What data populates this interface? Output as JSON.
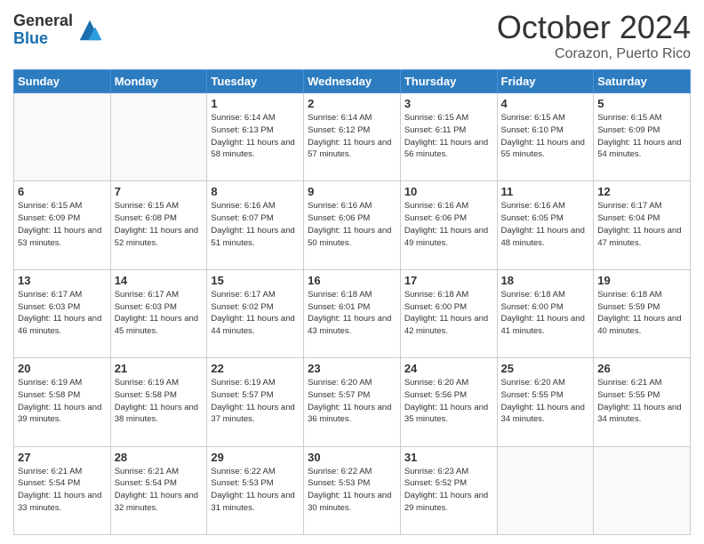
{
  "header": {
    "logo_general": "General",
    "logo_blue": "Blue",
    "month_title": "October 2024",
    "subtitle": "Corazon, Puerto Rico"
  },
  "days_of_week": [
    "Sunday",
    "Monday",
    "Tuesday",
    "Wednesday",
    "Thursday",
    "Friday",
    "Saturday"
  ],
  "weeks": [
    [
      {
        "day": "",
        "info": ""
      },
      {
        "day": "",
        "info": ""
      },
      {
        "day": "1",
        "info": "Sunrise: 6:14 AM\nSunset: 6:13 PM\nDaylight: 11 hours and 58 minutes."
      },
      {
        "day": "2",
        "info": "Sunrise: 6:14 AM\nSunset: 6:12 PM\nDaylight: 11 hours and 57 minutes."
      },
      {
        "day": "3",
        "info": "Sunrise: 6:15 AM\nSunset: 6:11 PM\nDaylight: 11 hours and 56 minutes."
      },
      {
        "day": "4",
        "info": "Sunrise: 6:15 AM\nSunset: 6:10 PM\nDaylight: 11 hours and 55 minutes."
      },
      {
        "day": "5",
        "info": "Sunrise: 6:15 AM\nSunset: 6:09 PM\nDaylight: 11 hours and 54 minutes."
      }
    ],
    [
      {
        "day": "6",
        "info": "Sunrise: 6:15 AM\nSunset: 6:09 PM\nDaylight: 11 hours and 53 minutes."
      },
      {
        "day": "7",
        "info": "Sunrise: 6:15 AM\nSunset: 6:08 PM\nDaylight: 11 hours and 52 minutes."
      },
      {
        "day": "8",
        "info": "Sunrise: 6:16 AM\nSunset: 6:07 PM\nDaylight: 11 hours and 51 minutes."
      },
      {
        "day": "9",
        "info": "Sunrise: 6:16 AM\nSunset: 6:06 PM\nDaylight: 11 hours and 50 minutes."
      },
      {
        "day": "10",
        "info": "Sunrise: 6:16 AM\nSunset: 6:06 PM\nDaylight: 11 hours and 49 minutes."
      },
      {
        "day": "11",
        "info": "Sunrise: 6:16 AM\nSunset: 6:05 PM\nDaylight: 11 hours and 48 minutes."
      },
      {
        "day": "12",
        "info": "Sunrise: 6:17 AM\nSunset: 6:04 PM\nDaylight: 11 hours and 47 minutes."
      }
    ],
    [
      {
        "day": "13",
        "info": "Sunrise: 6:17 AM\nSunset: 6:03 PM\nDaylight: 11 hours and 46 minutes."
      },
      {
        "day": "14",
        "info": "Sunrise: 6:17 AM\nSunset: 6:03 PM\nDaylight: 11 hours and 45 minutes."
      },
      {
        "day": "15",
        "info": "Sunrise: 6:17 AM\nSunset: 6:02 PM\nDaylight: 11 hours and 44 minutes."
      },
      {
        "day": "16",
        "info": "Sunrise: 6:18 AM\nSunset: 6:01 PM\nDaylight: 11 hours and 43 minutes."
      },
      {
        "day": "17",
        "info": "Sunrise: 6:18 AM\nSunset: 6:00 PM\nDaylight: 11 hours and 42 minutes."
      },
      {
        "day": "18",
        "info": "Sunrise: 6:18 AM\nSunset: 6:00 PM\nDaylight: 11 hours and 41 minutes."
      },
      {
        "day": "19",
        "info": "Sunrise: 6:18 AM\nSunset: 5:59 PM\nDaylight: 11 hours and 40 minutes."
      }
    ],
    [
      {
        "day": "20",
        "info": "Sunrise: 6:19 AM\nSunset: 5:58 PM\nDaylight: 11 hours and 39 minutes."
      },
      {
        "day": "21",
        "info": "Sunrise: 6:19 AM\nSunset: 5:58 PM\nDaylight: 11 hours and 38 minutes."
      },
      {
        "day": "22",
        "info": "Sunrise: 6:19 AM\nSunset: 5:57 PM\nDaylight: 11 hours and 37 minutes."
      },
      {
        "day": "23",
        "info": "Sunrise: 6:20 AM\nSunset: 5:57 PM\nDaylight: 11 hours and 36 minutes."
      },
      {
        "day": "24",
        "info": "Sunrise: 6:20 AM\nSunset: 5:56 PM\nDaylight: 11 hours and 35 minutes."
      },
      {
        "day": "25",
        "info": "Sunrise: 6:20 AM\nSunset: 5:55 PM\nDaylight: 11 hours and 34 minutes."
      },
      {
        "day": "26",
        "info": "Sunrise: 6:21 AM\nSunset: 5:55 PM\nDaylight: 11 hours and 34 minutes."
      }
    ],
    [
      {
        "day": "27",
        "info": "Sunrise: 6:21 AM\nSunset: 5:54 PM\nDaylight: 11 hours and 33 minutes."
      },
      {
        "day": "28",
        "info": "Sunrise: 6:21 AM\nSunset: 5:54 PM\nDaylight: 11 hours and 32 minutes."
      },
      {
        "day": "29",
        "info": "Sunrise: 6:22 AM\nSunset: 5:53 PM\nDaylight: 11 hours and 31 minutes."
      },
      {
        "day": "30",
        "info": "Sunrise: 6:22 AM\nSunset: 5:53 PM\nDaylight: 11 hours and 30 minutes."
      },
      {
        "day": "31",
        "info": "Sunrise: 6:23 AM\nSunset: 5:52 PM\nDaylight: 11 hours and 29 minutes."
      },
      {
        "day": "",
        "info": ""
      },
      {
        "day": "",
        "info": ""
      }
    ]
  ]
}
